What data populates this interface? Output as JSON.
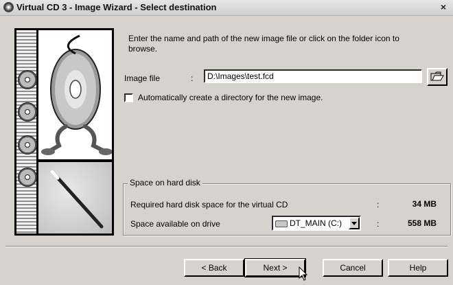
{
  "window": {
    "title": "Virtual CD 3 - Image Wizard - Select destination",
    "close_label": "×"
  },
  "main": {
    "description": "Enter the name and path of the new image file or click on the folder icon to browse.",
    "image_file": {
      "label": "Image file",
      "colon": ":",
      "value": "D:\\Images\\test.fcd"
    },
    "auto_dir": {
      "label": "Automatically create a directory for the new image.",
      "checked": false
    }
  },
  "space": {
    "title": "Space on hard disk",
    "required": {
      "label": "Required hard disk space for the virtual CD",
      "colon": ":",
      "value": "34 MB"
    },
    "available": {
      "label": "Space available on drive",
      "drive": "DT_MAIN (C:)",
      "colon": ":",
      "value": "558 MB"
    }
  },
  "buttons": {
    "back": "< Back",
    "next": "Next >",
    "cancel": "Cancel",
    "help": "Help"
  },
  "icons": {
    "folder": "open-folder-icon",
    "drive": "hard-drive-icon",
    "dropdown": "chevron-down-icon"
  }
}
